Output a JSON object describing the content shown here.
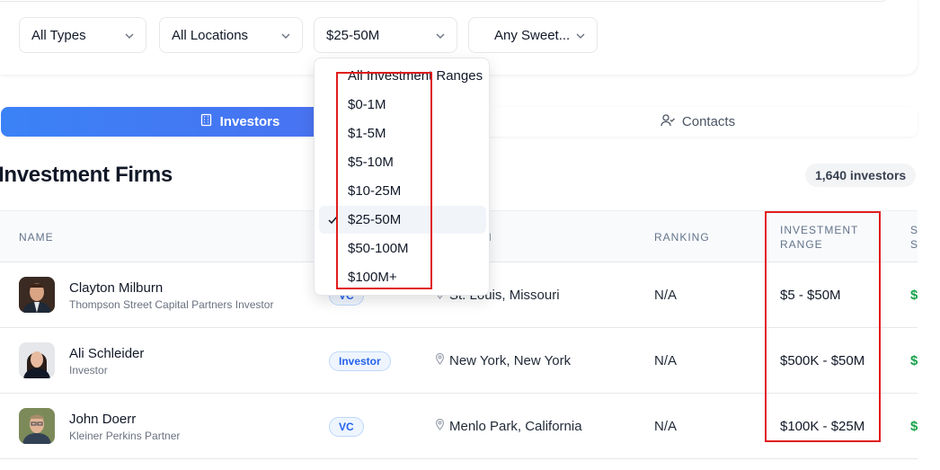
{
  "filters": [
    {
      "label": "All Types"
    },
    {
      "label": "All Locations"
    },
    {
      "label": "$25-50M"
    },
    {
      "label": "Any Sweet..."
    }
  ],
  "tabs": {
    "investors": "Investors",
    "contacts": "Contacts"
  },
  "section": {
    "title": "Investment Firms",
    "count": "1,640 investors"
  },
  "table": {
    "columns": {
      "name": "NAME",
      "location_partial": "N",
      "ranking": "RANKING",
      "range_line1": "INVESTMENT",
      "range_line2": "RANGE",
      "next_line1": "S",
      "next_line2": "S"
    },
    "rows": [
      {
        "name": "Clayton Milburn",
        "title": "Thompson Street Capital Partners Investor",
        "type": "VC",
        "location": "St. Louis, Missouri",
        "ranking": "N/A",
        "range": "$5 - $50M",
        "next": "$"
      },
      {
        "name": "Ali Schleider",
        "title": "Investor",
        "type": "Investor",
        "location": "New York, New York",
        "ranking": "N/A",
        "range": "$500K - $50M",
        "next": "$"
      },
      {
        "name": "John Doerr",
        "title": "Kleiner Perkins Partner",
        "type": "VC",
        "location": "Menlo Park, California",
        "ranking": "N/A",
        "range": "$100K - $25M",
        "next": "$"
      }
    ]
  },
  "dropdown": {
    "options": [
      "All Investment Ranges",
      "$0-1M",
      "$1-5M",
      "$5-10M",
      "$10-25M",
      "$25-50M",
      "$50-100M",
      "$100M+"
    ],
    "selected_index": 5
  },
  "colors": {
    "accent_gradient_start": "#3b82f6",
    "accent_gradient_end": "#4f6bef",
    "highlight_box": "#e11d1d",
    "next_column": "#16a34a"
  }
}
